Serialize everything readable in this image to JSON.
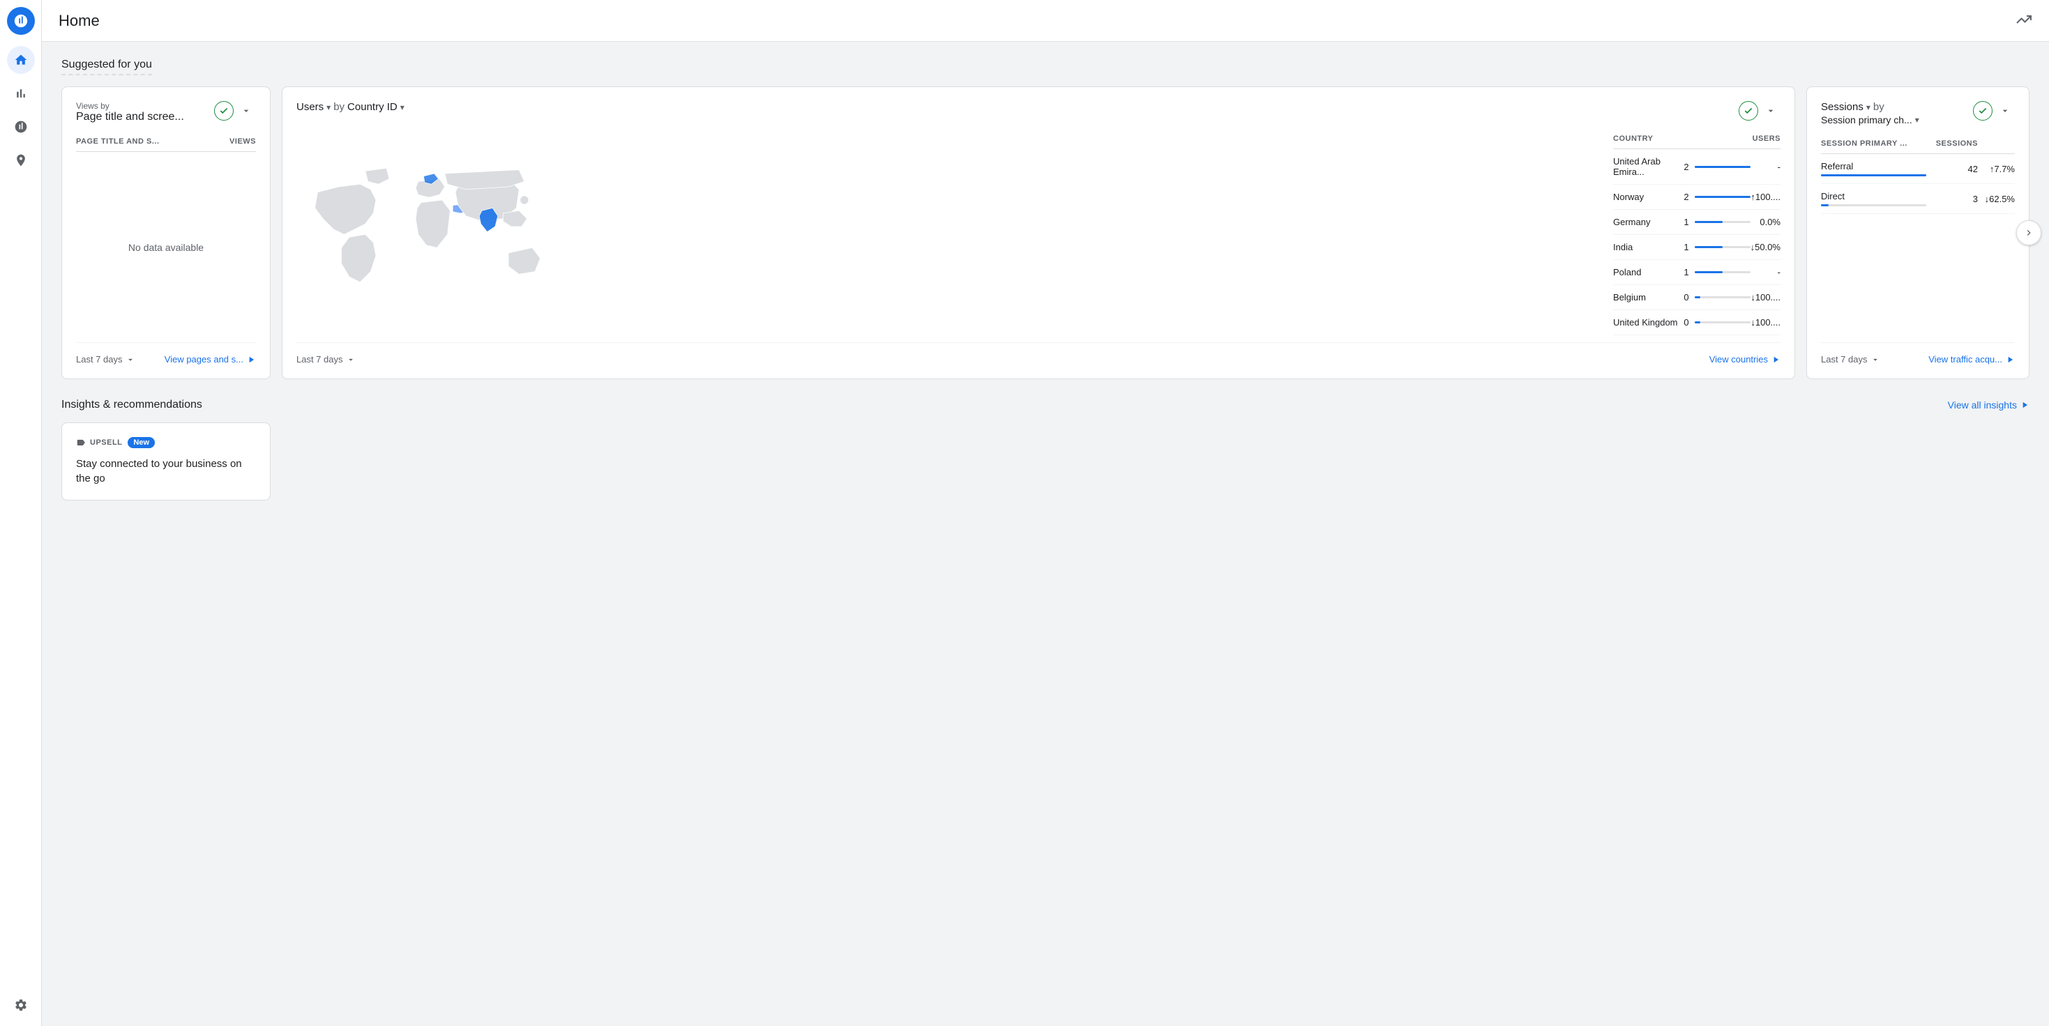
{
  "header": {
    "title": "Home",
    "icon_label": "analytics-icon"
  },
  "sidebar": {
    "logo_label": "google-analytics-logo",
    "items": [
      {
        "id": "home",
        "icon": "home-icon",
        "active": true
      },
      {
        "id": "reports",
        "icon": "bar-chart-icon",
        "active": false
      },
      {
        "id": "explore",
        "icon": "explore-icon",
        "active": false
      },
      {
        "id": "advertising",
        "icon": "advertising-icon",
        "active": false
      }
    ],
    "bottom_items": [
      {
        "id": "settings",
        "icon": "settings-icon"
      }
    ]
  },
  "suggested_section": {
    "title": "Suggested for you"
  },
  "card1": {
    "label": "Views by",
    "title": "Page title and scree...",
    "col1_header": "PAGE TITLE AND S...",
    "col2_header": "VIEWS",
    "no_data_text": "No data available",
    "footer_period": "Last 7 days",
    "footer_link": "View pages and s...",
    "check_icon": "✓",
    "dropdown_icon": "▾"
  },
  "card2": {
    "label": "Users",
    "label_arrow": "▾",
    "by": "by",
    "dimension": "Country ID",
    "dimension_arrow": "▾",
    "col1_header": "COUNTRY",
    "col2_header": "USERS",
    "footer_period": "Last 7 days",
    "footer_link": "View countries",
    "countries": [
      {
        "name": "United Arab Emira...",
        "users": 2,
        "bar": 100,
        "change": "-",
        "change_type": "neutral"
      },
      {
        "name": "Norway",
        "users": 2,
        "bar": 100,
        "change": "↑100....",
        "change_type": "up"
      },
      {
        "name": "Germany",
        "users": 1,
        "bar": 50,
        "change": "0.0%",
        "change_type": "neutral"
      },
      {
        "name": "India",
        "users": 1,
        "bar": 50,
        "change": "↓50.0%",
        "change_type": "down"
      },
      {
        "name": "Poland",
        "users": 1,
        "bar": 50,
        "change": "-",
        "change_type": "neutral"
      },
      {
        "name": "Belgium",
        "users": 0,
        "bar": 10,
        "change": "↓100....",
        "change_type": "down"
      },
      {
        "name": "United Kingdom",
        "users": 0,
        "bar": 10,
        "change": "↓100....",
        "change_type": "down"
      }
    ]
  },
  "card3": {
    "label": "Sessions",
    "label_arrow": "▾",
    "by": "by",
    "dimension": "Session primary ch...",
    "dimension_arrow": "▾",
    "col1_header": "SESSION PRIMARY ...",
    "col2_header": "SESSIONS",
    "footer_period": "Last 7 days",
    "footer_link": "View traffic acqu...",
    "rows": [
      {
        "name": "Referral",
        "value": 42,
        "bar": 100,
        "change": "↑7.7%",
        "change_type": "up"
      },
      {
        "name": "Direct",
        "value": 3,
        "bar": 7,
        "change": "↓62.5%",
        "change_type": "down"
      }
    ]
  },
  "insights_section": {
    "title": "Insights & recommendations",
    "view_all_link": "View all insights",
    "card": {
      "tag": "UPSELL",
      "badge": "New",
      "text": "Stay connected to your business on the go"
    }
  }
}
